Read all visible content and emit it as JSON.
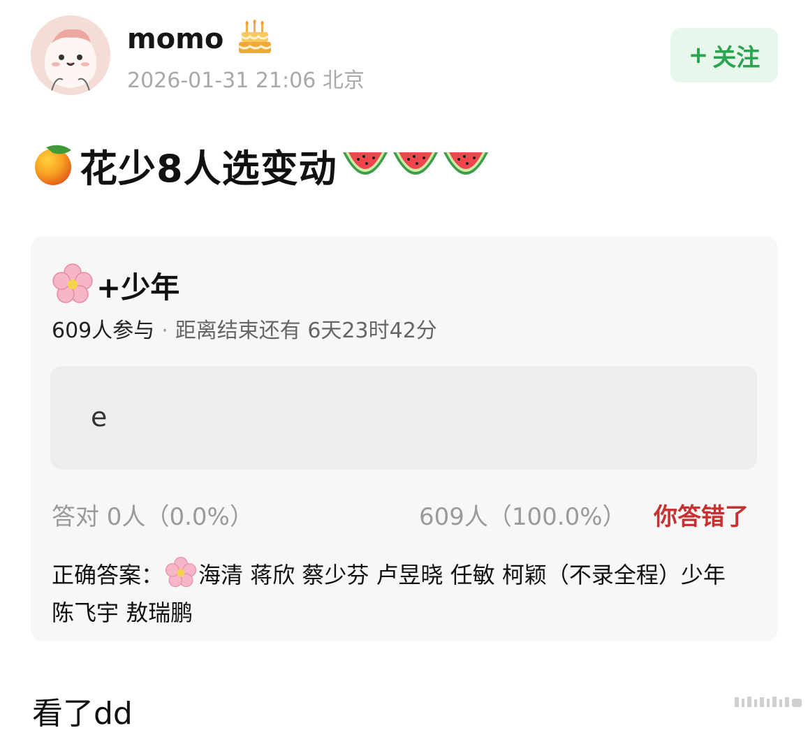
{
  "header": {
    "username": "momo",
    "datetime": "2026-01-31 21:06",
    "location": "北京",
    "follow_label": "关注",
    "follow_plus": "+"
  },
  "post": {
    "title_text": "花少8人选变动"
  },
  "quiz": {
    "title_text": "+少年",
    "participants": "609人参与",
    "separator": "·",
    "remaining": "距离结束还有 6天23时42分",
    "option_text": "e",
    "correct_stat": "答对  0人（0.0%）",
    "wrong_stat": "609人（100.0%）",
    "result_label": "你答错了",
    "answer_label": "正确答案：",
    "answer_text": "海清 蒋欣 蔡少芬 卢昱晓 任敏 柯颖（不录全程）少年 陈飞宇 敖瑞鹏"
  },
  "comment": {
    "text": "看了dd"
  },
  "colors": {
    "follow_green": "#2aa44e",
    "follow_bg": "#e8f7ec",
    "wrong_red": "#c93030",
    "card_bg": "#f7f7f7"
  },
  "icons": [
    "avatar-image",
    "birthday-cake-icon",
    "mango-emoji",
    "watermelon-emoji",
    "cherry-blossom-emoji"
  ]
}
